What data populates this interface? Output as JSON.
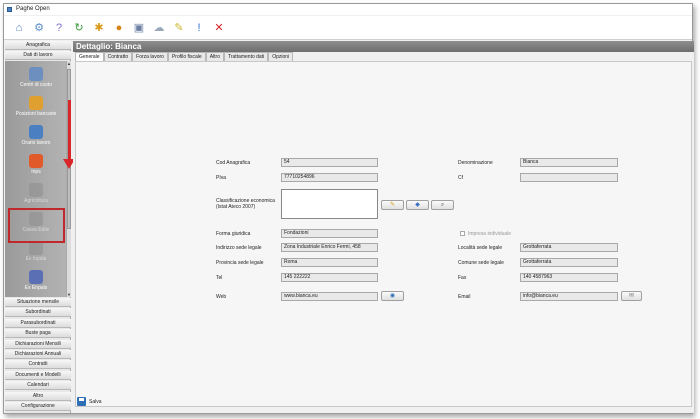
{
  "window": {
    "title": "Paghe Open"
  },
  "toolbar": {
    "buttons": [
      {
        "name": "home-icon",
        "glyph": "⌂",
        "color": "#4a7fc2"
      },
      {
        "name": "settings-icon",
        "glyph": "⚙",
        "color": "#5b8fc9"
      },
      {
        "name": "help-icon",
        "glyph": "?",
        "color": "#7a6fc9"
      },
      {
        "name": "refresh-icon",
        "glyph": "↻",
        "color": "#3b9a3b"
      },
      {
        "name": "bug-icon",
        "glyph": "✱",
        "color": "#d89a1a"
      },
      {
        "name": "user-icon",
        "glyph": "●",
        "color": "#d8831a"
      },
      {
        "name": "network-icon",
        "glyph": "▣",
        "color": "#6c7fa3"
      },
      {
        "name": "cloud-icon",
        "glyph": "☁",
        "color": "#9aa8b8"
      },
      {
        "name": "notes-icon",
        "glyph": "✎",
        "color": "#c9b82a"
      },
      {
        "name": "info-icon",
        "glyph": "!",
        "color": "#2f6fd1"
      },
      {
        "name": "close-icon",
        "glyph": "✕",
        "color": "#d9262b"
      }
    ]
  },
  "sidebar": {
    "top_headers": [
      "Anagrafica",
      "Dati di lavoro"
    ],
    "items": [
      {
        "label": "Centri di costo",
        "icon": "cost-centers-icon",
        "color": "#6c8fc0",
        "enabled": true
      },
      {
        "label": "Posizioni bancarie",
        "icon": "bank-icon",
        "color": "#e0a030",
        "enabled": true
      },
      {
        "label": "Orario lavoro",
        "icon": "clock-icon",
        "color": "#4a7fc2",
        "enabled": true
      },
      {
        "label": "Inps",
        "icon": "lifebuoy-icon",
        "color": "#e05a2a",
        "enabled": true
      },
      {
        "label": "Agricoltura",
        "icon": "agriculture-icon",
        "color": "#888888",
        "enabled": false
      },
      {
        "label": "Cassa Edile",
        "icon": "construction-icon",
        "color": "#888888",
        "enabled": false
      },
      {
        "label": "Ex Inpdai",
        "icon": "inpdai-icon",
        "color": "#888888",
        "enabled": false
      },
      {
        "label": "Ex Enpals",
        "icon": "theater-masks-icon",
        "color": "#5b6fb5",
        "enabled": true
      }
    ],
    "bottom_headers": [
      "Situazione mensile",
      "Subordinati",
      "Parasubordinati",
      "Buste paga",
      "Dichiarazioni Mensili",
      "Dichiarazioni Annuali",
      "Contratti",
      "Documenti e Modelli",
      "Calendari",
      "Altro",
      "Configurazione"
    ]
  },
  "main": {
    "header": "Dettaglio: Bianca",
    "tabs": [
      "Generale",
      "Contratto",
      "Forza lavoro",
      "Profilo fiscale",
      "Altro",
      "Trattamento dati",
      "Opzioni"
    ],
    "active_tab": "Generale"
  },
  "form": {
    "cod_anagrafica": {
      "label": "Cod Anagrafica",
      "value": "54"
    },
    "piva": {
      "label": "PIva",
      "value": "77710254896"
    },
    "classificazione": {
      "label": "Classificazione economica (Istat Ateco 2007)",
      "value": ""
    },
    "forma_giuridica": {
      "label": "Forma giuridica",
      "value": "Fondazioni"
    },
    "indirizzo": {
      "label": "Indirizzo sede legale",
      "value": "Zona Industriale Enrico Fermi, 458"
    },
    "provincia": {
      "label": "Provincia sede legale",
      "value": "Roma"
    },
    "tel": {
      "label": "Tel",
      "value": "145 222222"
    },
    "web": {
      "label": "Web",
      "value": "www.bianca.eu"
    },
    "denominazione": {
      "label": "Denominazione",
      "value": "Bianca"
    },
    "cf": {
      "label": "Cf",
      "value": ""
    },
    "impresa_individuale": {
      "label": "Impresa individuale",
      "checked": false
    },
    "localita": {
      "label": "Località sede legale",
      "value": "Grottaferrata"
    },
    "comune": {
      "label": "Comune sede legale",
      "value": "Grottaferrata"
    },
    "fax": {
      "label": "Fax",
      "value": "140 4587963"
    },
    "email": {
      "label": "Email",
      "value": "info@bianca.eu"
    }
  },
  "footer": {
    "save_label": "Salva"
  }
}
